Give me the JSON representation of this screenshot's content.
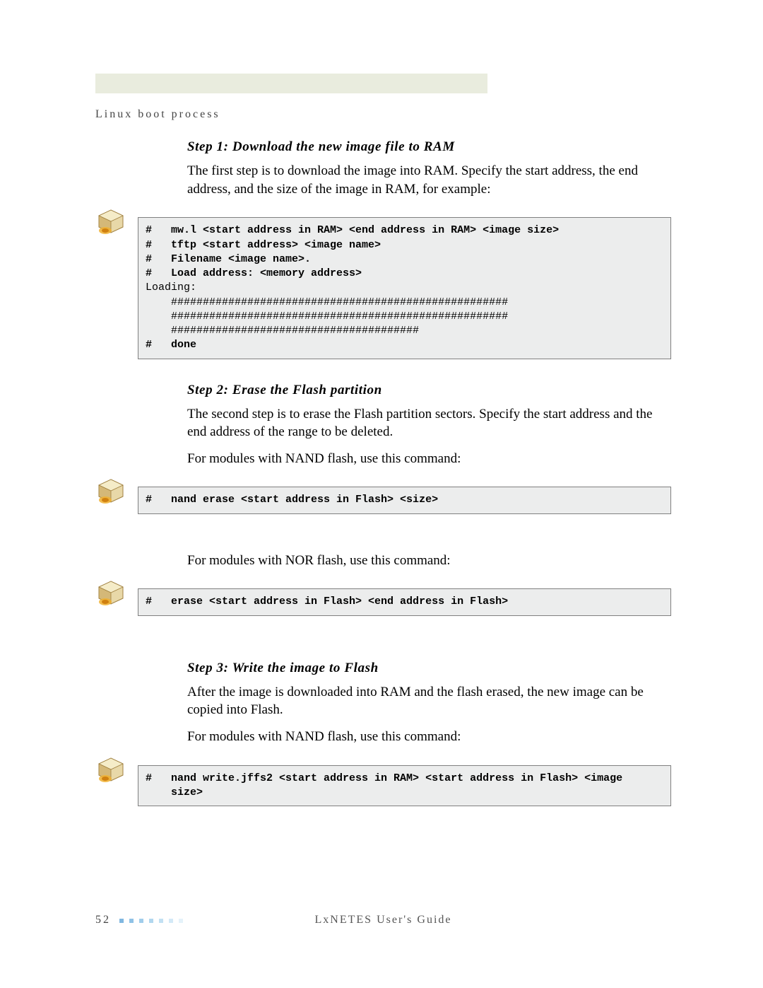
{
  "header": {
    "section_title": "Linux boot process"
  },
  "steps": [
    {
      "title": "Step 1: Download the new image file to RAM",
      "paragraphs": [
        "The first step is to download the image into RAM. Specify the start address, the end address, and the size of the image in RAM, for example:"
      ],
      "code": "#   mw.l <start address in RAM> <end address in RAM> <image size>\n#   tftp <start address> <image name>\n#   Filename <image name>.\n#   Load address: <memory address>\nLoading:\n    #####################################################\n    #####################################################\n    #######################################\n#   done",
      "code_bold_lines": [
        0,
        1,
        2,
        3,
        8
      ]
    },
    {
      "title": "Step 2: Erase the Flash partition",
      "paragraphs": [
        "The second step is to erase the Flash partition sectors. Specify the start address and the end address of the range to be deleted.",
        "For modules with NAND flash, use this command:"
      ],
      "code": "#   nand erase <start address in Flash> <size>",
      "after_paragraphs": [
        "For modules with NOR flash, use this command:"
      ],
      "code2": "#   erase <start address in Flash> <end address in Flash>"
    },
    {
      "title": "Step 3: Write the image to Flash",
      "paragraphs": [
        "After the image is downloaded into RAM and the flash erased, the new image can be copied into Flash.",
        "For modules with NAND flash, use this command:"
      ],
      "code": "#   nand write.jffs2 <start address in RAM> <start address in Flash> <image\n    size>"
    }
  ],
  "footer": {
    "page_number": "52",
    "guide": "LxNETES User's Guide"
  },
  "colors": {
    "square1": "#80b7e0",
    "square2": "#8fc2e6",
    "square3": "#a0cdeb",
    "square4": "#b1d7ef",
    "square5": "#c2e0f3",
    "square6": "#d3e9f7",
    "square7": "#e4f2fa"
  }
}
